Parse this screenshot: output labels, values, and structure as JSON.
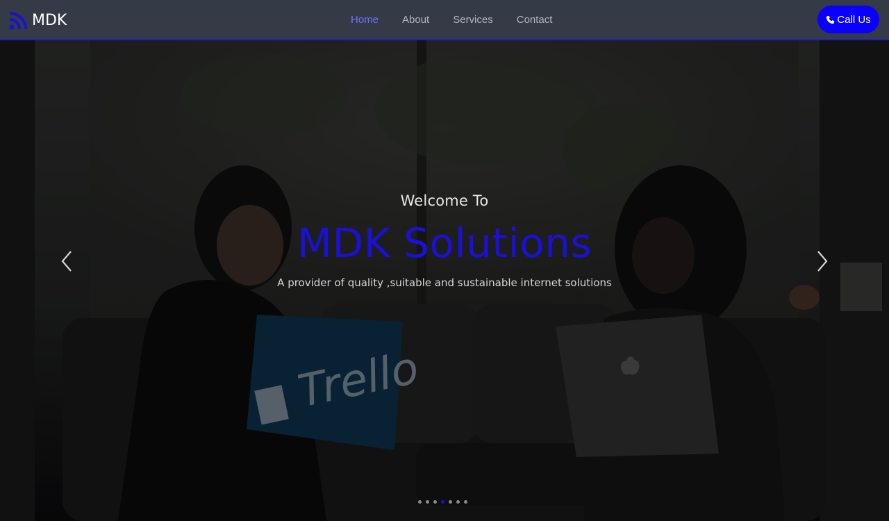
{
  "brand": {
    "name": "MDK",
    "icon": "rss-feed-icon",
    "color": "#1a10d6"
  },
  "nav": {
    "items": [
      {
        "label": "Home",
        "active": true
      },
      {
        "label": "About",
        "active": false
      },
      {
        "label": "Services",
        "active": false
      },
      {
        "label": "Contact",
        "active": false
      }
    ],
    "active_color": "#6f74ff",
    "bar_color": "#343a46",
    "accent_border": "#1a1ae0"
  },
  "call_button": {
    "label": "Call Us",
    "icon": "phone-icon",
    "color": "#0a00ff"
  },
  "hero": {
    "welcome": "Welcome To",
    "title": "MDK Solutions",
    "subtitle": "A provider of quality ,suitable and sustainable internet solutions",
    "title_color": "#1a10d6",
    "prev_icon": "chevron-left-icon",
    "next_icon": "chevron-right-icon",
    "slide_indicators": 7,
    "active_slide": 4
  }
}
